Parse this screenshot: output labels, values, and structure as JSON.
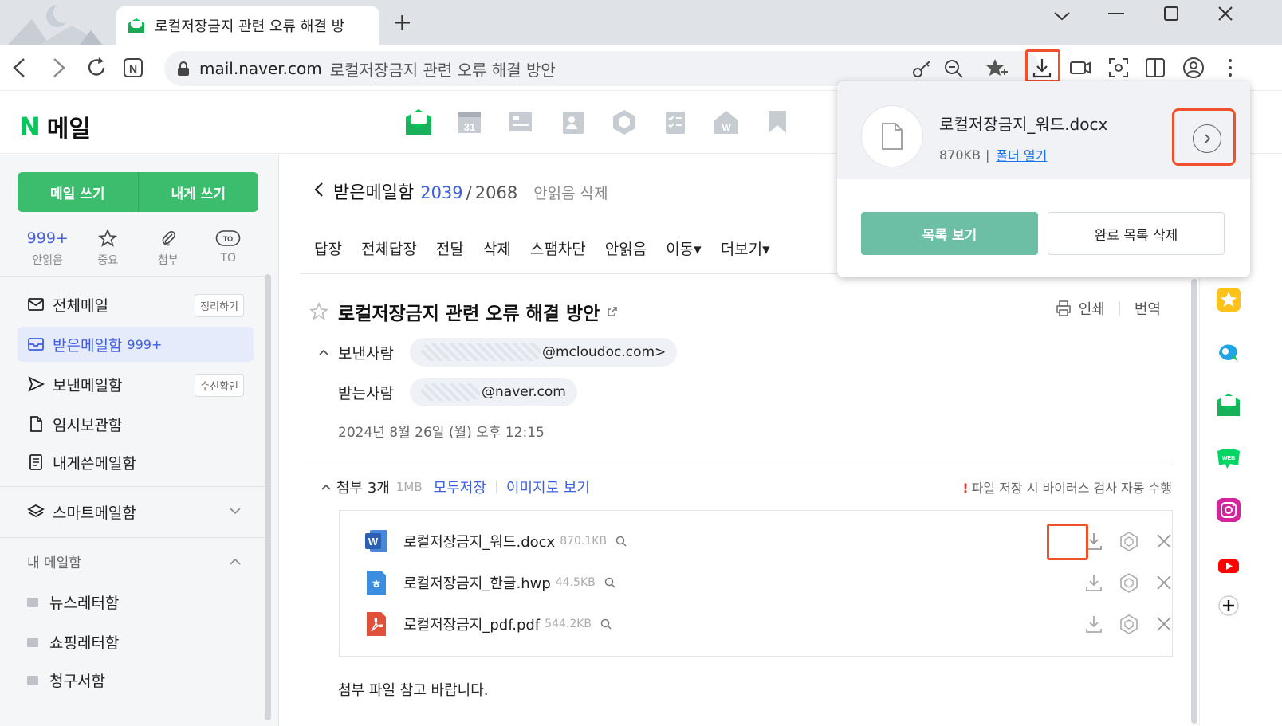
{
  "browser": {
    "tab_title": "로컬저장금지 관련 오류 해결 방",
    "newtab_label": "+",
    "address_host": "mail.naver.com",
    "address_title": "로컬저장금지 관련 오류 해결 방안"
  },
  "download_popup": {
    "file_name": "로컬저장금지_워드.docx",
    "file_size": "870KB",
    "meta_sep": "|",
    "open_folder": "폴더 열기",
    "list_button": "목록 보기",
    "clear_button": "완료 목록 삭제"
  },
  "naver": {
    "logo_n": "N",
    "logo_text": "메일"
  },
  "sidebar": {
    "write_mail": "메일 쓰기",
    "write_self": "내게 쓰기",
    "quick": [
      {
        "top": "999+",
        "label": "안읽음",
        "icon": "count"
      },
      {
        "top": "",
        "label": "중요",
        "icon": "star-icon"
      },
      {
        "top": "",
        "label": "첨부",
        "icon": "paperclip-icon"
      },
      {
        "top": "",
        "label": "TO",
        "icon": "to-badge-icon"
      }
    ],
    "items": [
      {
        "label": "전체메일",
        "chip": "정리하기"
      },
      {
        "label": "받은메일함",
        "count": "999+"
      },
      {
        "label": "보낸메일함",
        "chip": "수신확인"
      },
      {
        "label": "임시보관함"
      },
      {
        "label": "내게쓴메일함"
      }
    ],
    "smart": "스마트메일함",
    "my_section": "내 메일함",
    "folders": [
      "뉴스레터함",
      "쇼핑레터함",
      "청구서함"
    ]
  },
  "main": {
    "folder_name": "받은메일함",
    "unread_count": "2039",
    "slash": "/",
    "total_count": "2068",
    "delete_unread": "안읽음 삭제",
    "actions": [
      "답장",
      "전체답장",
      "전달",
      "삭제",
      "스팸차단",
      "안읽음",
      "이동▾",
      "더보기▾"
    ],
    "subject": "로컬저장금지 관련 오류 해결 방안",
    "print": "인쇄",
    "translate": "번역",
    "from_label": "보낸사람",
    "from_addr": "@mcloudoc.com>",
    "to_label": "받는사람",
    "to_addr": "@naver.com",
    "date": "2024년 8월 26일 (월) 오후 12:15",
    "attach_title": "첨부 3개",
    "attach_size": "1MB",
    "save_all": "모두저장",
    "view_as_image": "이미지로 보기",
    "warn_mark": "!",
    "virus_note": "파일 저장 시 바이러스 검사 자동 수행",
    "attachments": [
      {
        "name": "로컬저장금지_워드.docx",
        "size": "870.1KB",
        "type": "word"
      },
      {
        "name": "로컬저장금지_한글.hwp",
        "size": "44.5KB",
        "type": "hwp"
      },
      {
        "name": "로컬저장금지_pdf.pdf",
        "size": "544.2KB",
        "type": "pdf"
      }
    ],
    "body": "첨부 파일 참고 바랍니다."
  },
  "colors": {
    "naver_green": "#03c75a",
    "accent_blue": "#3d5ee0",
    "highlight": "#f0502c"
  }
}
